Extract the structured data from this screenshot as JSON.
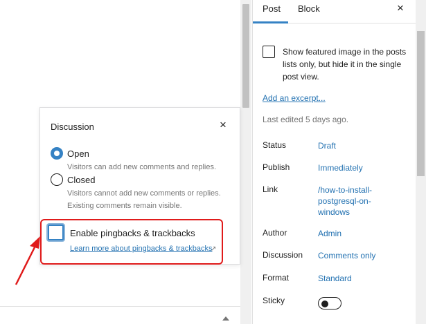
{
  "discussion_popover": {
    "title": "Discussion",
    "close_icon": "×",
    "options": [
      {
        "label": "Open",
        "help": "Visitors can add new comments and replies.",
        "selected": true
      },
      {
        "label": "Closed",
        "help": "Visitors cannot add new comments or replies. Existing comments remain visible.",
        "selected": false
      }
    ],
    "pingbacks": {
      "label": "Enable pingbacks & trackbacks",
      "link": "Learn more about pingbacks & trackbacks",
      "external_icon": "↗",
      "checked": false
    }
  },
  "sidebar": {
    "tabs": [
      {
        "label": "Post",
        "active": true
      },
      {
        "label": "Block",
        "active": false
      }
    ],
    "close_icon": "×",
    "featured_image_checkbox": {
      "label": "Show featured image in the posts lists only, but hide it in the single post view.",
      "checked": false
    },
    "excerpt_link": "Add an excerpt...",
    "last_edited": "Last edited 5 days ago.",
    "rows": {
      "status": {
        "label": "Status",
        "value": "Draft"
      },
      "publish": {
        "label": "Publish",
        "value": "Immediately"
      },
      "link": {
        "label": "Link",
        "value": "/how-to-install-postgresql-on-windows"
      },
      "author": {
        "label": "Author",
        "value": "Admin"
      },
      "discussion": {
        "label": "Discussion",
        "value": "Comments only"
      },
      "format": {
        "label": "Format",
        "value": "Standard"
      },
      "sticky": {
        "label": "Sticky",
        "enabled": false
      }
    }
  },
  "colors": {
    "accent": "#3582c4",
    "link": "#2271b1",
    "annotation": "#e01b1b",
    "muted_text": "#757575"
  }
}
